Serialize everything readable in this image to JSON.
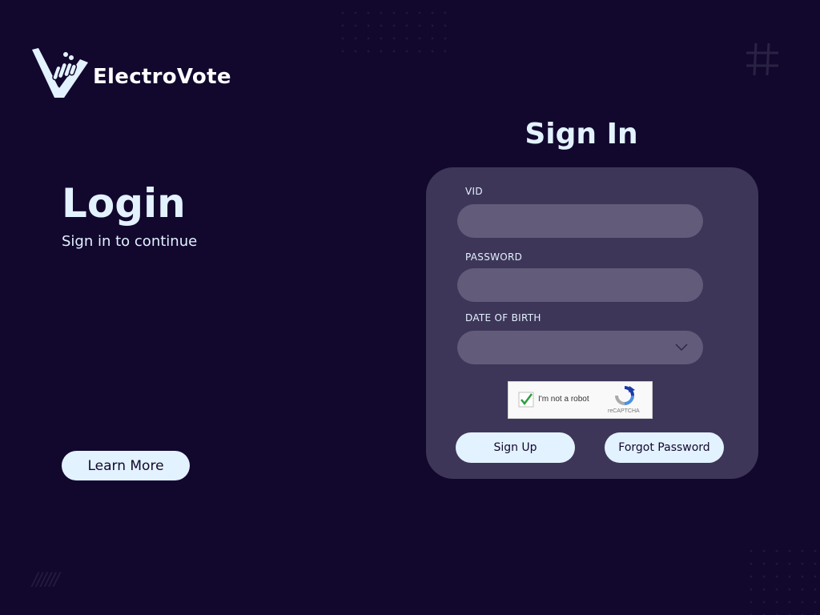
{
  "brand": {
    "name": "ElectroVote",
    "logo_icon": "v-ballot-hand-icon",
    "accent": "#e3f2ff",
    "background": "#12082e"
  },
  "intro": {
    "title": "Login",
    "subtitle": "Sign in to continue",
    "learn_more_label": "Learn More"
  },
  "signin": {
    "heading": "Sign In",
    "card_color": "#3e3658",
    "fields": {
      "vid": {
        "label": "VID",
        "value": "",
        "placeholder": ""
      },
      "password": {
        "label": "PASSWORD",
        "value": "",
        "placeholder": ""
      },
      "dob": {
        "label": "DATE OF BIRTH",
        "selected": ""
      }
    },
    "captcha": {
      "text": "I'm not a robot",
      "brand": "reCAPTCHA",
      "checked": true
    },
    "buttons": {
      "signup_label": "Sign Up",
      "forgot_label": "Forgot Password"
    }
  }
}
